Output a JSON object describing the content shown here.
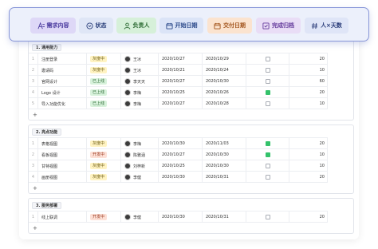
{
  "toolbar": {
    "fields": [
      {
        "label": "需求内容",
        "icon": "text-icon",
        "bg": "#ded8f7",
        "color": "#4a3a9e"
      },
      {
        "label": "状态",
        "icon": "status-icon",
        "bg": "#dfe6f6",
        "color": "#2a3f7a"
      },
      {
        "label": "负责人",
        "icon": "person-icon",
        "bg": "#d6f0d9",
        "color": "#2d6b34"
      },
      {
        "label": "开始日期",
        "icon": "calendar-icon",
        "bg": "#dbe4f7",
        "color": "#2c4a8a"
      },
      {
        "label": "交付日期",
        "icon": "calendar-icon",
        "bg": "#fbe3cf",
        "color": "#a2541c"
      },
      {
        "label": "完成归档",
        "icon": "checkbox-icon",
        "bg": "#e9ddf6",
        "color": "#62389a"
      },
      {
        "label": "人×天数",
        "icon": "hash-icon",
        "bg": "#dfe5f7",
        "color": "#2c3e7a"
      }
    ]
  },
  "status_colors": {
    "灰度中": {
      "bg": "#fff3c2",
      "color": "#6b5a10"
    },
    "已上线": {
      "bg": "#d8f2dc",
      "color": "#2c6b35"
    },
    "开发中": {
      "bg": "#fde0d6",
      "color": "#9b3a20"
    }
  },
  "groups": [
    {
      "title": "1. 通用能力",
      "rows": [
        {
          "idx": "1",
          "name": "注册登录",
          "status": "灰度中",
          "owner": "王冰",
          "start": "2020/10/27",
          "due": "2020/10/29",
          "done": false,
          "days": "20"
        },
        {
          "idx": "2",
          "name": "邀请码",
          "status": "灰度中",
          "owner": "王冰",
          "start": "2020/10/21",
          "due": "2020/10/24",
          "done": false,
          "days": "10"
        },
        {
          "idx": "3",
          "name": "官网设计",
          "status": "已上线",
          "owner": "李天天",
          "start": "2020/10/27",
          "due": "2020/10/30",
          "done": false,
          "days": "60"
        },
        {
          "idx": "4",
          "name": "Logo 设计",
          "status": "已上线",
          "owner": "李梅",
          "start": "2020/10/25",
          "due": "2020/10/26",
          "done": true,
          "days": "20"
        },
        {
          "idx": "5",
          "name": "导入功能优化",
          "status": "已上线",
          "owner": "李梅",
          "start": "2020/10/27",
          "due": "2020/10/28",
          "done": false,
          "days": "10"
        }
      ]
    },
    {
      "title": "2. 亮点功能",
      "rows": [
        {
          "idx": "1",
          "name": "表格视图",
          "status": "灰度中",
          "owner": "李梅",
          "start": "2020/10/30",
          "due": "2020/11/03",
          "done": true,
          "days": "20"
        },
        {
          "idx": "2",
          "name": "看板视图",
          "status": "开发中",
          "owner": "陈雅涵",
          "start": "2020/10/27",
          "due": "2020/10/30",
          "done": true,
          "days": "10"
        },
        {
          "idx": "3",
          "name": "甘特视图",
          "status": "灰度中",
          "owner": "刘梓新",
          "start": "2020/10/25",
          "due": "2020/10/30",
          "done": false,
          "days": "10"
        },
        {
          "idx": "4",
          "name": "画册视图",
          "status": "灰度中",
          "owner": "李健",
          "start": "2020/10/30",
          "due": "2020/10/31",
          "done": false,
          "days": "20"
        }
      ]
    },
    {
      "title": "3. 服务部署",
      "rows": [
        {
          "idx": "1",
          "name": "线上联调",
          "status": "开发中",
          "owner": "李健",
          "start": "2020/10/30",
          "due": "2020/10/31",
          "done": false,
          "days": "20"
        }
      ]
    }
  ],
  "add_symbol": "+"
}
